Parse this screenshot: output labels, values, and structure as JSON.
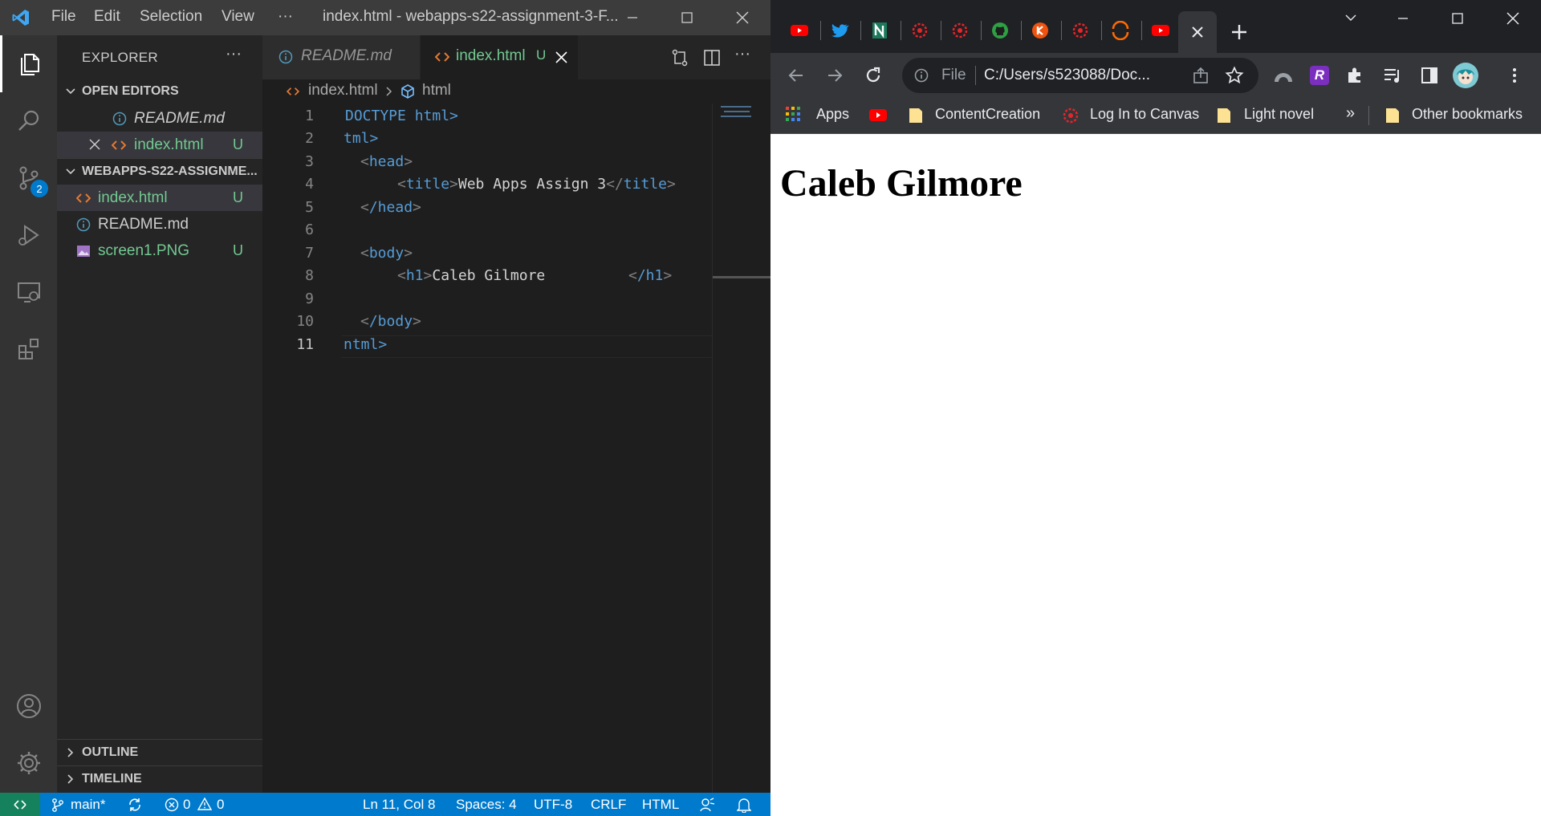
{
  "vscode": {
    "menu": [
      "File",
      "Edit",
      "Selection",
      "View"
    ],
    "menu_more": "···",
    "window_title": "index.html - webapps-s22-assignment-3-F...",
    "sidebar": {
      "title": "EXPLORER",
      "more": "···",
      "open_editors_label": "OPEN EDITORS",
      "open_editors": [
        {
          "name": "README.md",
          "status": ""
        },
        {
          "name": "index.html",
          "status": "U"
        }
      ],
      "project_label": "WEBAPPS-S22-ASSIGNME...",
      "files": [
        {
          "name": "index.html",
          "status": "U"
        },
        {
          "name": "README.md",
          "status": ""
        },
        {
          "name": "screen1.PNG",
          "status": "U"
        }
      ],
      "outline_label": "OUTLINE",
      "timeline_label": "TIMELINE",
      "scm_badge": "2"
    },
    "tabs": [
      {
        "label": "README.md",
        "status": ""
      },
      {
        "label": "index.html",
        "status": "U"
      }
    ],
    "breadcrumb": {
      "file": "index.html",
      "symbol": "html"
    },
    "line_numbers": [
      "1",
      "2",
      "3",
      "4",
      "5",
      "6",
      "7",
      "8",
      "9",
      "10",
      "11"
    ],
    "code": {
      "l1": "DOCTYPE html>",
      "l2": "tml>",
      "l3_tag": "head",
      "l4_title_text": "Web Apps Assign 3",
      "l4_tag": "title",
      "l5_tag": "/head",
      "l7_tag": "body",
      "l8_tag": "h1",
      "l8_text": "Caleb Gilmore",
      "l8_close": "/h1",
      "l10_tag": "/body",
      "l11": "ntml>"
    },
    "status": {
      "branch": "main*",
      "errors": "0",
      "warnings": "0",
      "position": "Ln 11, Col 8",
      "spaces": "Spaces: 4",
      "encoding": "UTF-8",
      "eol": "CRLF",
      "language": "HTML"
    }
  },
  "chrome": {
    "tab_icons": [
      "youtube-icon",
      "twitter-icon",
      "notion-icon",
      "canvas-icon",
      "canvas-icon",
      "github-icon",
      "app-icon",
      "canvas-icon",
      "swirl-icon",
      "youtube-icon"
    ],
    "omnibox": {
      "scheme_label": "File",
      "url": "C:/Users/s523088/Doc..."
    },
    "bookmarks": [
      {
        "label": "Apps",
        "icon": "apps-grid-icon"
      },
      {
        "label": "",
        "icon": "youtube-icon"
      },
      {
        "label": "ContentCreation",
        "icon": "folder-icon"
      },
      {
        "label": "Log In to Canvas",
        "icon": "canvas-icon"
      },
      {
        "label": "Light novel",
        "icon": "folder-icon"
      }
    ],
    "bookmarks_overflow": "»",
    "other_bookmarks": "Other bookmarks",
    "page": {
      "heading": "Caleb Gilmore"
    }
  },
  "colors": {
    "vscode_accent": "#007acc",
    "git_untracked": "#73c991",
    "chrome_dark": "#202124",
    "youtube_red": "#ff0000",
    "canvas_red": "#e72429"
  }
}
